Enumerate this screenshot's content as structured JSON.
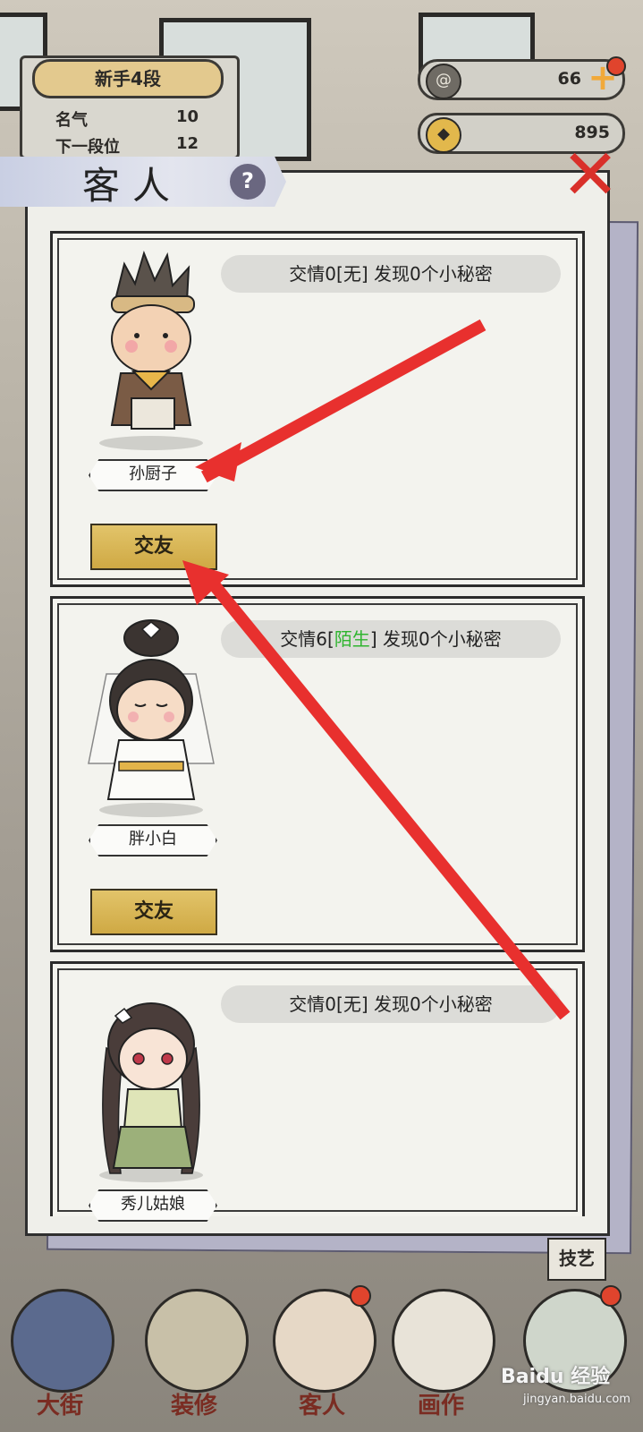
{
  "hud": {
    "rank": "新手4段",
    "stats": [
      {
        "label": "名气",
        "value": "10"
      },
      {
        "label": "下一段位",
        "value": "12"
      }
    ],
    "resources": [
      {
        "icon": "swirl-icon",
        "value": "66"
      },
      {
        "icon": "coin-icon",
        "value": "895"
      }
    ]
  },
  "panel": {
    "title": "客人",
    "help": "?"
  },
  "guests": [
    {
      "info_prefix": "交情0[",
      "relation": "无",
      "info_suffix": "] 发现0个小秘密",
      "name": "孙厨子",
      "button": "交友",
      "relation_color": "#222222"
    },
    {
      "info_prefix": "交情6[",
      "relation": "陌生",
      "info_suffix": "] 发现0个小秘密",
      "name": "胖小白",
      "button": "交友",
      "relation_color": "#2fb52f"
    },
    {
      "info_prefix": "交情0[",
      "relation": "无",
      "info_suffix": "] 发现0个小秘密",
      "name": "秀儿姑娘",
      "button": "",
      "relation_color": "#222222"
    }
  ],
  "side": {
    "skill": "技艺"
  },
  "nav": [
    {
      "label": "大街",
      "icon": "street-icon"
    },
    {
      "label": "装修",
      "icon": "decorate-icon"
    },
    {
      "label": "客人",
      "icon": "guest-icon"
    },
    {
      "label": "画作",
      "icon": "painting-icon"
    },
    {
      "label": "",
      "icon": "craft-icon"
    }
  ],
  "watermark": {
    "main": "Baidu 经验",
    "sub": "jingyan.baidu.com"
  }
}
